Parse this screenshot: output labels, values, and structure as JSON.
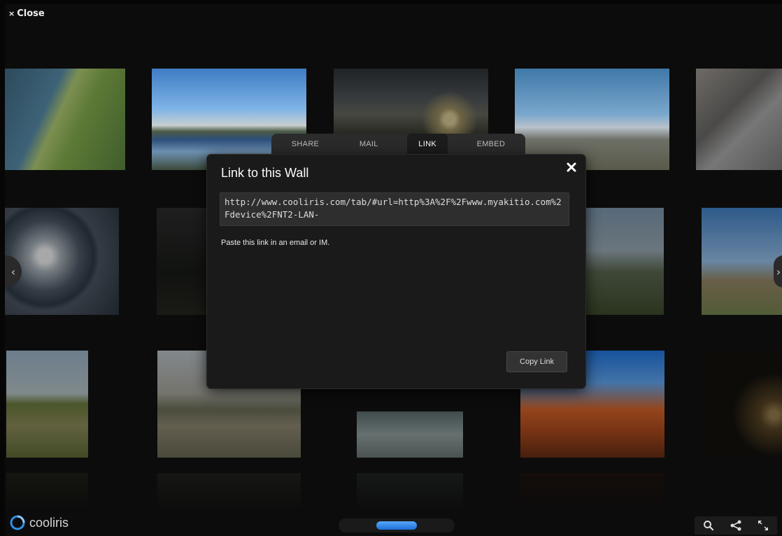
{
  "window": {
    "close_label": "Close"
  },
  "share_tabs": [
    {
      "label": "SHARE",
      "active": false
    },
    {
      "label": "MAIL",
      "active": false
    },
    {
      "label": "LINK",
      "active": true
    },
    {
      "label": "EMBED",
      "active": false
    }
  ],
  "dialog": {
    "title": "Link to this Wall",
    "link_value": "http://www.cooliris.com/tab/#url=http%3A%2F%2Fwww.myakitio.com%2Fdevice%2FNT2-LAN-",
    "hint": "Paste this link in an email or IM.",
    "copy_button_label": "Copy Link"
  },
  "brand": {
    "name": "cooliris",
    "accent": "#2f8fe6"
  },
  "icons": {
    "close": "close-x",
    "search": "magnifier",
    "share": "share-nodes",
    "fullscreen": "expand-arrows",
    "prev": "chevron-left",
    "next": "chevron-right"
  },
  "colors": {
    "background": "#0c0c0c",
    "dialog_bg": "#1a1a1a",
    "scroll_thumb": "#2f8fe6"
  }
}
